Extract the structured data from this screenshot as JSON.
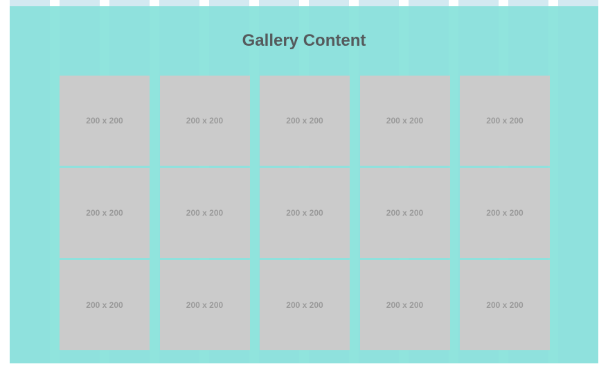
{
  "gallery": {
    "title": "Gallery Content",
    "items": [
      {
        "label": "200 x 200"
      },
      {
        "label": "200 x 200"
      },
      {
        "label": "200 x 200"
      },
      {
        "label": "200 x 200"
      },
      {
        "label": "200 x 200"
      },
      {
        "label": "200 x 200"
      },
      {
        "label": "200 x 200"
      },
      {
        "label": "200 x 200"
      },
      {
        "label": "200 x 200"
      },
      {
        "label": "200 x 200"
      },
      {
        "label": "200 x 200"
      },
      {
        "label": "200 x 200"
      },
      {
        "label": "200 x 200"
      },
      {
        "label": "200 x 200"
      },
      {
        "label": "200 x 200"
      }
    ]
  },
  "colors": {
    "panel": "#7ddcd6",
    "thumb": "#cbcbcb",
    "title": "#555a5c",
    "label": "#9a9a9a"
  }
}
